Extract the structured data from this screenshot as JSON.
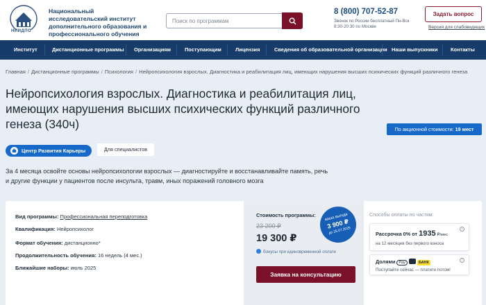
{
  "header": {
    "logo_text": "НИИДПО",
    "org_name": "Национальный исследовательский институт дополнительного образования и профессионального обучения",
    "search_placeholder": "Поиск по программам",
    "phone": "8 (800) 707-52-87",
    "phone_note": "Звонок по России бесплатный Пн-Вск 8:30-20:30 по Москве",
    "ask_button": "Задать вопрос",
    "vision_link": "Версия для слабовидящих"
  },
  "nav": {
    "items": [
      "Институт",
      "Дистанционные программы",
      "Организациям",
      "Поступающим",
      "Лицензия",
      "Сведения об образовательной организации",
      "Наши выпускники",
      "Контакты"
    ]
  },
  "breadcrumb": {
    "items": [
      "Главная",
      "Дистанционные программы",
      "Психология",
      "Нейропсихология взрослых. Диагностика и реабилитация лиц, имеющих нарушения высших психических функций различного генеза"
    ],
    "separator": "/"
  },
  "page": {
    "title": "Нейропсихология взрослых. Диагностика и реабилитация лиц, имеющих нарушения высших психических функций различного генеза (340ч)",
    "promo_label": "По акционной стоимости:",
    "promo_value": "19 мест",
    "tag_career": "Центр Развития Карьеры",
    "tag_specialists": "Для специалистов",
    "description": "За 4 месяца освойте основы нейропсихологии взрослых — диагностируйте и восстанавливайте память, речь и другие функции у пациентов после инсульта, травм, иных поражений головного мозга"
  },
  "program": {
    "type_label": "Вид программы:",
    "type_value": "Профессиональная переподготовка",
    "qual_label": "Квалификация:",
    "qual_value": "Нейропсихолог",
    "format_label": "Формат обучения:",
    "format_value": "дистанционно*",
    "duration_label": "Продолжительность обучения:",
    "duration_value": "16 недель (4 мес.)",
    "intake_label": "Ближайшие наборы:",
    "intake_value": "июль 2025"
  },
  "price": {
    "label": "Стоимость программы:",
    "old": "23 200 ₽",
    "new": "19 300 ₽",
    "bonus": "бонусы при единовременной оплате",
    "badge_l1": "ваша выгода",
    "badge_l2": "3 900 ₽",
    "badge_l3": "до 25.07.2025",
    "consult_button": "Заявка на консультацию"
  },
  "payment": {
    "label": "Способы оплаты по частям:",
    "installment_prefix": "Рассрочка 0% от",
    "installment_amount": "1935",
    "installment_unit": "₽/мес",
    "installment_note": "на 12 месяцев без первого взноса",
    "parts_label": "Долями",
    "split_label": "Pay",
    "bank_label": "БАНК",
    "parts_note": "Поступайте сейчас — платите потом!",
    "info_icon": "i"
  }
}
